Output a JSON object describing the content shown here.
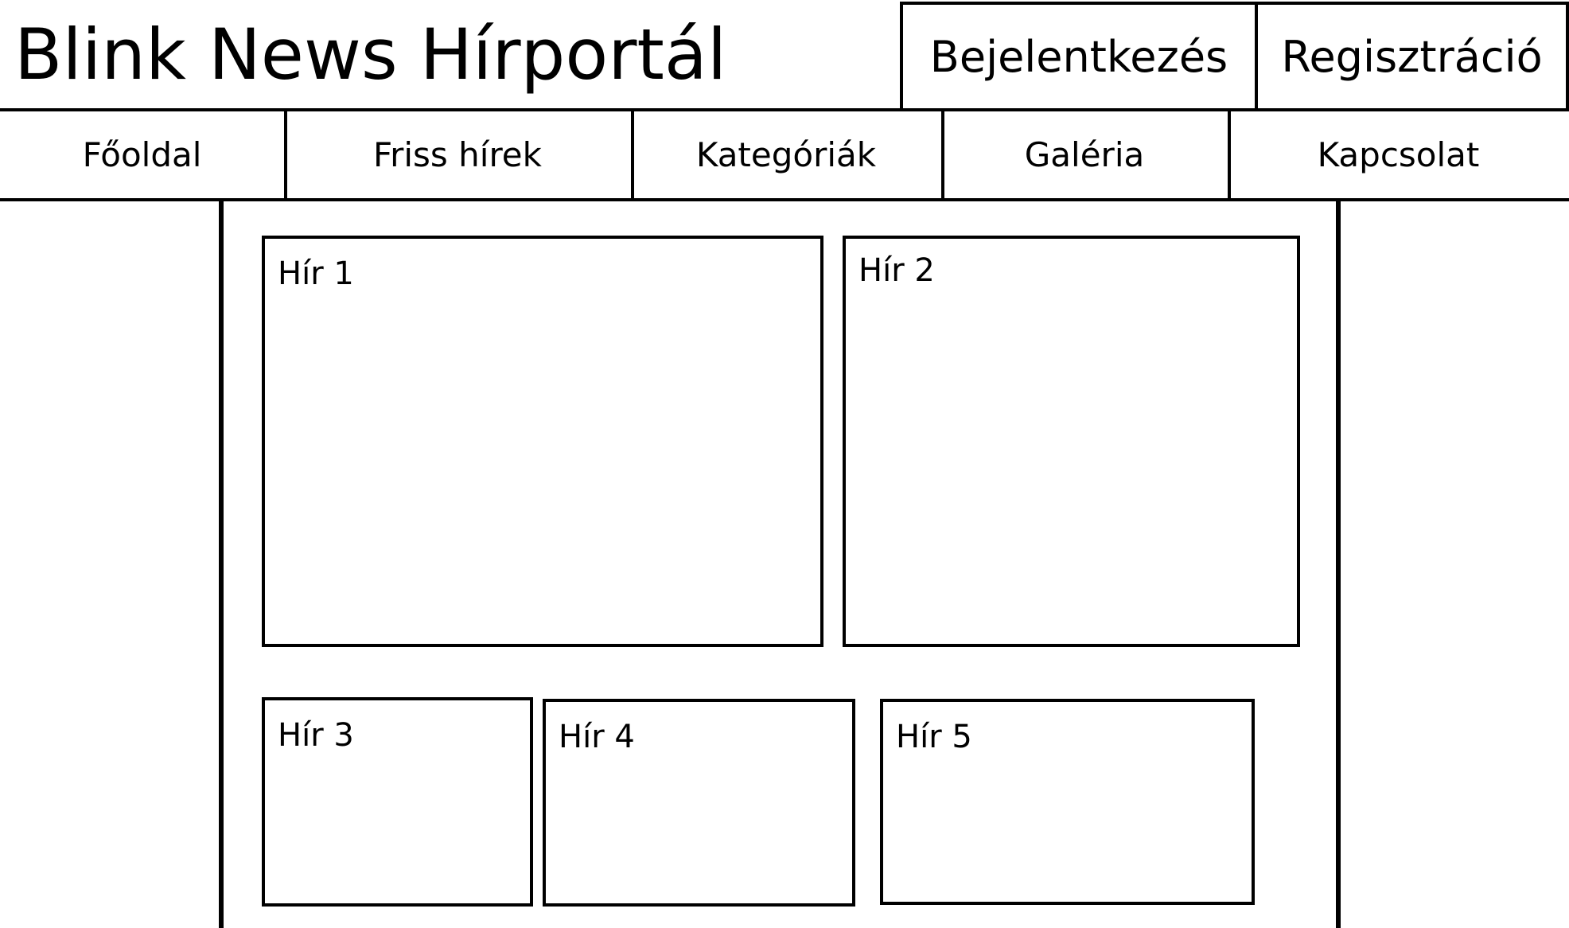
{
  "header": {
    "site_title": "Blink News Hírportál",
    "login_label": "Bejelentkezés",
    "register_label": "Regisztráció"
  },
  "nav": {
    "items": [
      {
        "label": "Főoldal"
      },
      {
        "label": "Friss hírek"
      },
      {
        "label": "Kategóriák"
      },
      {
        "label": "Galéria"
      },
      {
        "label": "Kapcsolat"
      }
    ]
  },
  "news": [
    {
      "label": "Hír 1"
    },
    {
      "label": "Hír 2"
    },
    {
      "label": "Hír 3"
    },
    {
      "label": "Hír 4"
    },
    {
      "label": "Hír 5"
    }
  ]
}
